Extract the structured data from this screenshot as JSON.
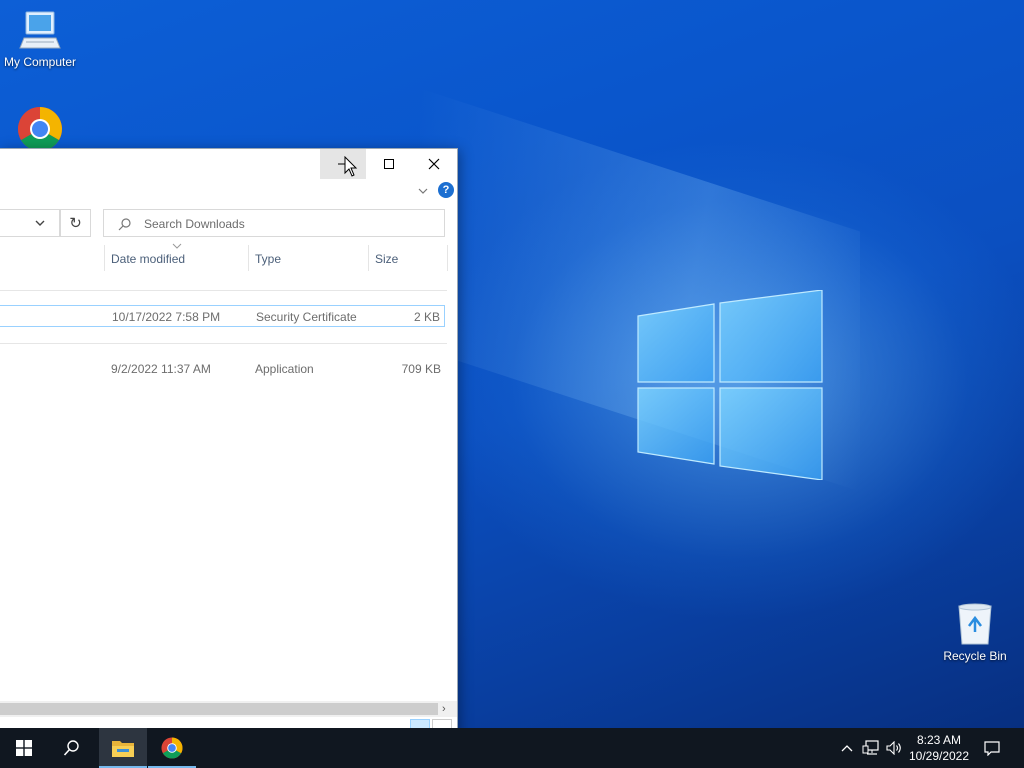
{
  "desktop": {
    "icons": [
      {
        "label": "My Computer",
        "icon": "monitor-icon"
      },
      {
        "label": "",
        "icon": "chrome-icon"
      },
      {
        "label": "Recycle Bin",
        "icon": "recycle-bin-icon"
      }
    ]
  },
  "explorer": {
    "titlebar": {
      "buttons": [
        "minimize-icon",
        "maximize-icon",
        "close-icon"
      ]
    },
    "ribbon": {
      "help_label": "?"
    },
    "address": {
      "refresh_glyph": "↻"
    },
    "search": {
      "placeholder": "Search Downloads"
    },
    "columns": {
      "date": "Date modified",
      "type": "Type",
      "size": "Size"
    },
    "files": [
      {
        "date": "10/17/2022 7:58 PM",
        "type": "Security Certificate",
        "size": "2 KB",
        "selected": true
      },
      {
        "date": "9/2/2022 11:37 AM",
        "type": "Application",
        "size": "709 KB",
        "selected": false
      }
    ]
  },
  "taskbar": {
    "items": [
      "windows-start-icon",
      "search-icon",
      "file-explorer-icon",
      "chrome-icon"
    ],
    "tray": [
      "chevron-up-icon",
      "network-icon",
      "volume-icon",
      "notification-icon"
    ],
    "time": "8:23 AM",
    "date": "10/29/2022"
  },
  "colors": {
    "accent": "#0078d7",
    "selection_border": "#99d1ff",
    "taskbar": "#101720"
  }
}
